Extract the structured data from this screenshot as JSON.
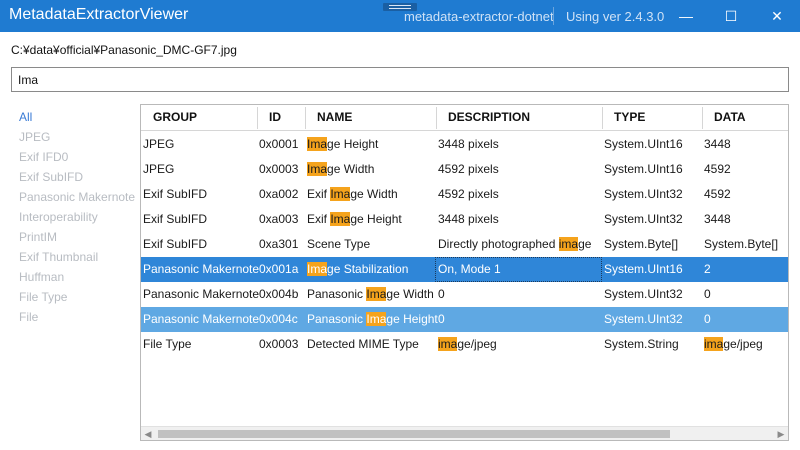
{
  "window": {
    "title": "MetadataExtractorViewer",
    "link_text": "metadata-extractor-dotnet",
    "version_text": "Using ver 2.4.3.0",
    "minimize_glyph": "—",
    "maximize_glyph": "☐",
    "close_glyph": "✕"
  },
  "file_path": "C:¥data¥official¥Panasonic_DMC-GF7.jpg",
  "search": {
    "value": "Ima",
    "placeholder": ""
  },
  "sidebar": {
    "items": [
      {
        "label": "All",
        "active": true
      },
      {
        "label": "JPEG"
      },
      {
        "label": "Exif IFD0"
      },
      {
        "label": "Exif SubIFD"
      },
      {
        "label": "Panasonic Makernote"
      },
      {
        "label": "Interoperability"
      },
      {
        "label": "PrintIM"
      },
      {
        "label": "Exif Thumbnail"
      },
      {
        "label": "Huffman"
      },
      {
        "label": "File Type"
      },
      {
        "label": "File"
      }
    ]
  },
  "grid": {
    "columns": [
      "GROUP",
      "ID",
      "NAME",
      "DESCRIPTION",
      "TYPE",
      "DATA"
    ],
    "highlight_term": "ima",
    "rows": [
      {
        "group": "JPEG",
        "id": "0x0001",
        "name": "Image Height",
        "description": "3448 pixels",
        "type": "System.UInt16",
        "data": "3448",
        "state": ""
      },
      {
        "group": "JPEG",
        "id": "0x0003",
        "name": "Image Width",
        "description": "4592 pixels",
        "type": "System.UInt16",
        "data": "4592",
        "state": ""
      },
      {
        "group": "Exif SubIFD",
        "id": "0xa002",
        "name": "Exif Image Width",
        "description": "4592 pixels",
        "type": "System.UInt32",
        "data": "4592",
        "state": ""
      },
      {
        "group": "Exif SubIFD",
        "id": "0xa003",
        "name": "Exif Image Height",
        "description": "3448 pixels",
        "type": "System.UInt32",
        "data": "3448",
        "state": ""
      },
      {
        "group": "Exif SubIFD",
        "id": "0xa301",
        "name": "Scene Type",
        "description": "Directly photographed image",
        "type": "System.Byte[]",
        "data": "System.Byte[]",
        "state": ""
      },
      {
        "group": "Panasonic Makernote",
        "id": "0x001a",
        "name": "Image Stabilization",
        "description": "On, Mode 1",
        "type": "System.UInt16",
        "data": "2",
        "state": "selected-focused"
      },
      {
        "group": "Panasonic Makernote",
        "id": "0x004b",
        "name": "Panasonic Image Width",
        "description": "0",
        "type": "System.UInt32",
        "data": "0",
        "state": ""
      },
      {
        "group": "Panasonic Makernote",
        "id": "0x004c",
        "name": "Panasonic Image Height",
        "description": "0",
        "type": "System.UInt32",
        "data": "0",
        "state": "selected"
      },
      {
        "group": "File Type",
        "id": "0x0003",
        "name": "Detected MIME Type",
        "description": "image/jpeg",
        "type": "System.String",
        "data": "image/jpeg",
        "state": ""
      }
    ]
  },
  "colors": {
    "titlebar": "#1f7bd1",
    "selected_row": "#2f86d8",
    "selected_row_secondary": "#5fa8e3",
    "highlight": "#f5a31c",
    "sidebar_active": "#3a7bd5",
    "sidebar_inactive": "#b8bcc2"
  }
}
